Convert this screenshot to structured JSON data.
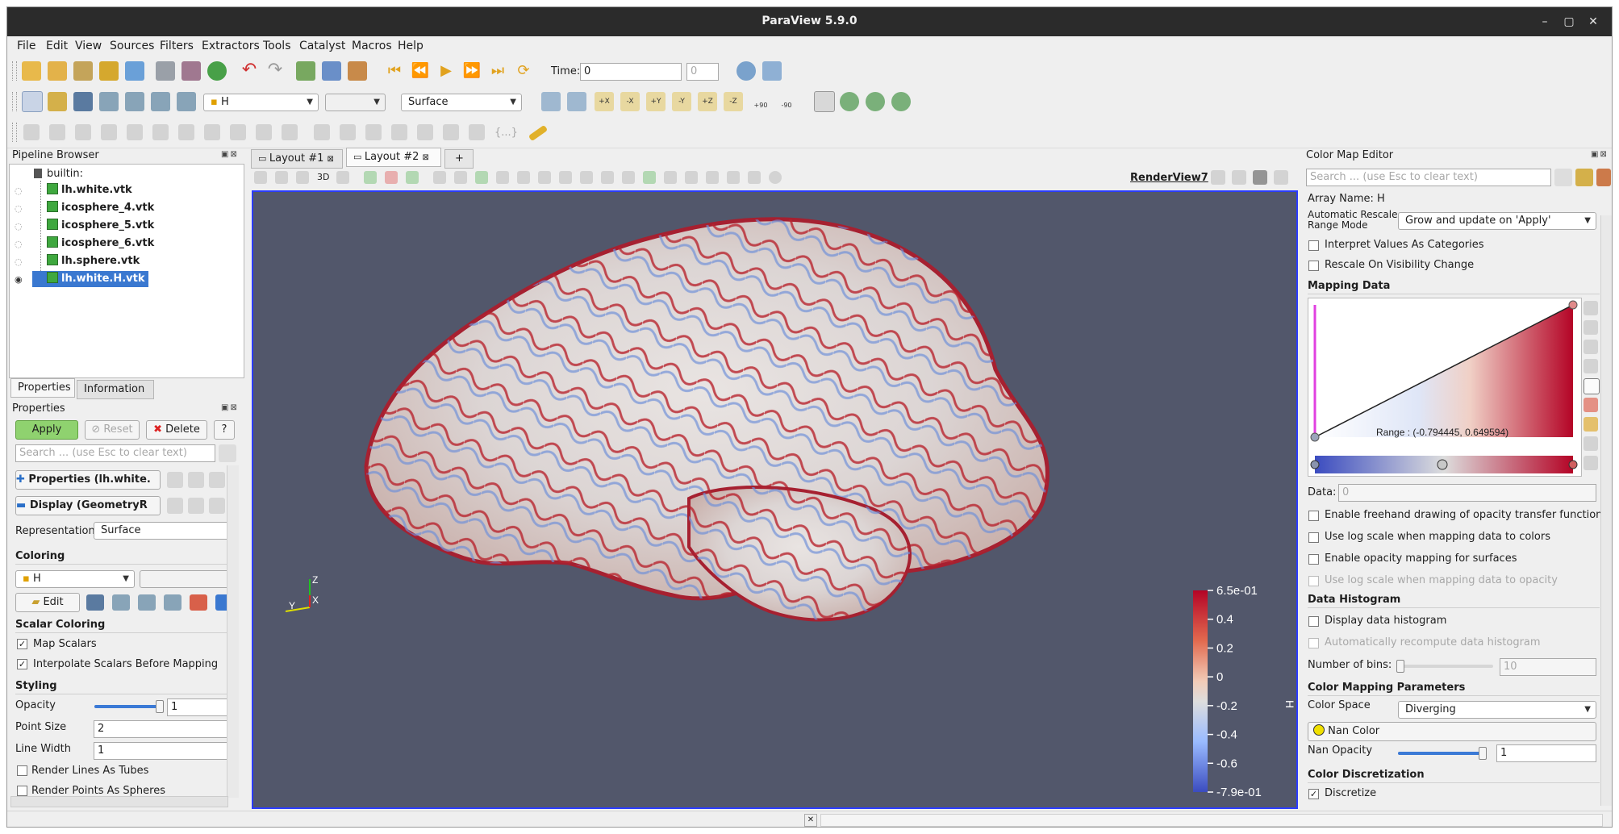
{
  "window": {
    "title": "ParaView 5.9.0"
  },
  "menu": [
    "File",
    "Edit",
    "View",
    "Sources",
    "Filters",
    "Extractors",
    "Tools",
    "Catalyst",
    "Macros",
    "Help"
  ],
  "toolbar": {
    "time_label": "Time:",
    "time_value": "0",
    "time_step": "0",
    "array_select": "H",
    "representation_select": "Surface",
    "rotate_plus": "+90",
    "rotate_minus": "-90",
    "camera_labels": [
      "+X",
      "-X",
      "+Y",
      "-Y",
      "+Z",
      "-Z"
    ],
    "python_label": "{...}"
  },
  "pipeline": {
    "title": "Pipeline Browser",
    "root": "builtin:",
    "items": [
      {
        "label": "lh.white.vtk"
      },
      {
        "label": "icosphere_4.vtk"
      },
      {
        "label": "icosphere_5.vtk"
      },
      {
        "label": "icosphere_6.vtk"
      },
      {
        "label": "lh.sphere.vtk"
      },
      {
        "label": "lh.white.H.vtk"
      }
    ]
  },
  "properties": {
    "tabs": [
      "Properties",
      "Information"
    ],
    "title": "Properties",
    "apply": "Apply",
    "reset": "Reset",
    "delete": "Delete",
    "help": "?",
    "search_placeholder": "Search ... (use Esc to clear text)",
    "group_properties": "Properties (lh.white.",
    "group_display": "Display (GeometryR",
    "representation_label": "Representation",
    "representation_value": "Surface",
    "coloring_section": "Coloring",
    "coloring_array": "H",
    "edit_label": "Edit",
    "scalar_section": "Scalar Coloring",
    "map_scalars": "Map Scalars",
    "interpolate": "Interpolate Scalars Before Mapping",
    "styling_section": "Styling",
    "opacity_label": "Opacity",
    "opacity_value": "1",
    "opacity_level": 1.0,
    "point_size_label": "Point Size",
    "point_size_value": "2",
    "line_width_label": "Line Width",
    "line_width_value": "1",
    "render_lines": "Render Lines As Tubes",
    "render_points": "Render Points As Spheres"
  },
  "layout": {
    "tabs": [
      "Layout #1",
      "Layout #2"
    ],
    "add_tab": "+",
    "view_name": "RenderView7",
    "three_d": "3D"
  },
  "scalar_bar": {
    "title": "H",
    "ticks": [
      "6.5e-01",
      "0.4",
      "0.2",
      "0",
      "-0.2",
      "-0.4",
      "-0.6",
      "-7.9e-01"
    ]
  },
  "axes": {
    "x": "X",
    "y": "Y",
    "z": "Z"
  },
  "colormap": {
    "title": "Color Map Editor",
    "search_placeholder": "Search ... (use Esc to clear text)",
    "array_name": "Array Name: H",
    "auto_rescale_label_1": "Automatic Rescale",
    "auto_rescale_label_2": "Range Mode",
    "auto_rescale_value": "Grow and update on 'Apply'",
    "interpret_categories": "Interpret Values As Categories",
    "rescale_visibility": "Rescale On Visibility Change",
    "mapping_data": "Mapping Data",
    "range_text": "Range : (-0.794445, 0.649594)",
    "data_label": "Data:",
    "data_value": "0",
    "freehand": "Enable freehand drawing of opacity transfer function",
    "log_colors": "Use log scale when mapping data to colors",
    "opacity_surfaces": "Enable opacity mapping for surfaces",
    "log_opacity": "Use log scale when mapping data to opacity",
    "histogram_section": "Data Histogram",
    "display_histogram": "Display data histogram",
    "auto_recompute": "Automatically recompute data histogram",
    "bins_label": "Number of bins:",
    "bins_value": "10",
    "params_section": "Color Mapping Parameters",
    "color_space_label": "Color Space",
    "color_space_value": "Diverging",
    "nan_color": "Nan Color",
    "nan_opacity_label": "Nan Opacity",
    "nan_opacity_value": "1",
    "nan_opacity_level": 1.0,
    "discretization_section": "Color Discretization",
    "discretize": "Discretize"
  },
  "colors": {
    "accent": "#3a78d0",
    "background_view": "#52576b",
    "cmap_low": "#3b4cc0",
    "cmap_high": "#b40426"
  }
}
